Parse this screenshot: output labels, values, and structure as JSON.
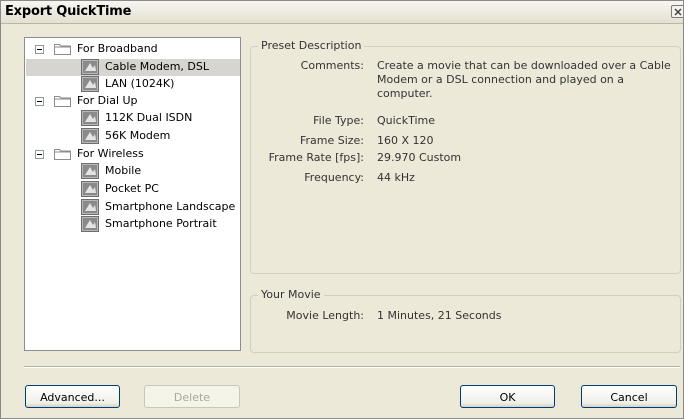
{
  "window": {
    "title": "Export QuickTime"
  },
  "tree": {
    "groups": [
      {
        "label": "For Broadband",
        "items": [
          "Cable Modem, DSL",
          "LAN (1024K)"
        ]
      },
      {
        "label": "For Dial Up",
        "items": [
          "112K  Dual ISDN",
          "56K Modem"
        ]
      },
      {
        "label": "For Wireless",
        "items": [
          "Mobile",
          "Pocket PC",
          "Smartphone Landscape",
          "Smartphone Portrait"
        ]
      }
    ],
    "selected": "Cable Modem, DSL"
  },
  "preset": {
    "legend": "Preset Description",
    "comments_label": "Comments:",
    "comments_line1": "Create a movie that can be downloaded over a Cable",
    "comments_line2": "Modem or a DSL connection and played on a computer.",
    "file_type_label": "File Type:",
    "file_type": "QuickTime",
    "frame_size_label": "Frame Size:",
    "frame_size": "160 X 120",
    "frame_rate_label": "Frame Rate [fps]:",
    "frame_rate": "29.970 Custom",
    "frequency_label": "Frequency:",
    "frequency": "44 kHz"
  },
  "movie": {
    "legend": "Your Movie",
    "length_label": "Movie Length:",
    "length": "1 Minutes, 21 Seconds"
  },
  "buttons": {
    "advanced": "Advanced...",
    "delete": "Delete",
    "ok": "OK",
    "cancel": "Cancel"
  },
  "icons": {
    "close": "close-icon",
    "folder": "folder-icon",
    "preset": "quicktime-preset-icon",
    "expander": "collapse-minus-icon"
  }
}
